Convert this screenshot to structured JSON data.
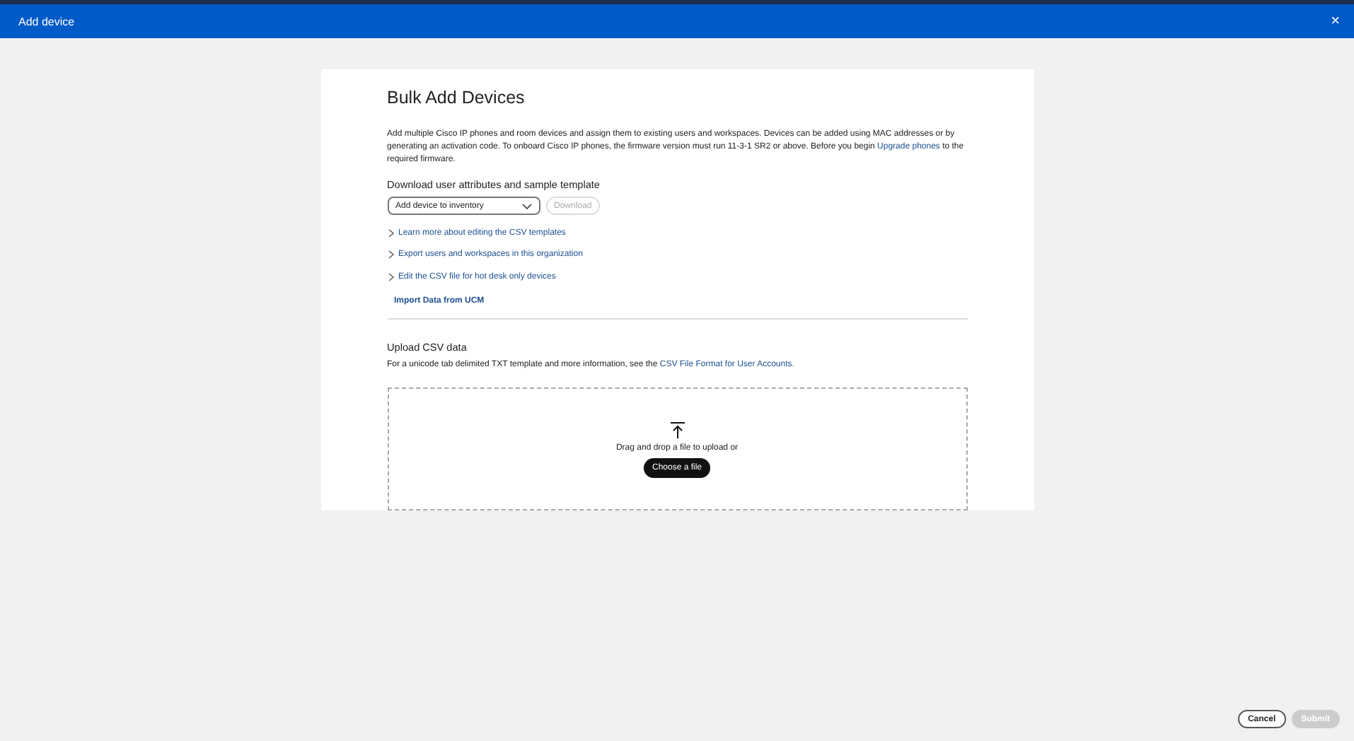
{
  "window": {
    "title": "Add device",
    "close_label": "×"
  },
  "title": "Bulk Add Devices",
  "intro": {
    "text": "Add multiple Cisco IP phones and room devices and assign them to existing users and workspaces. Devices can be added using MAC addresses or by generating an activation code. To onboard Cisco IP phones, the firmware version must run 11-3-1 SR2 or above. Before you begin ",
    "link": "Upgrade phones",
    "after": " to the required firmware."
  },
  "download": {
    "heading": "Download user attributes and sample template",
    "select_value": "Add device to inventory",
    "button": {
      "label": "Download",
      "disabled": true
    }
  },
  "links": [
    {
      "label": "Learn more about editing the CSV templates",
      "expanded": false
    },
    {
      "label": "Export users and workspaces in this organization",
      "expanded": false
    },
    {
      "label": "Edit the CSV file for hot desk only devices",
      "expanded": false
    }
  ],
  "import_link": "Import Data from UCM",
  "upload": {
    "heading": "Upload CSV data",
    "note": "For a unicode tab delimited TXT template and more information, see the ",
    "note_link": "CSV File Format for User Accounts.",
    "drop_text": "Drag and drop a file to upload or",
    "choose_button": "Choose a file"
  },
  "footer": [
    {
      "label": "Cancel",
      "disabled": false
    },
    {
      "label": "Submit",
      "disabled": true
    }
  ]
}
